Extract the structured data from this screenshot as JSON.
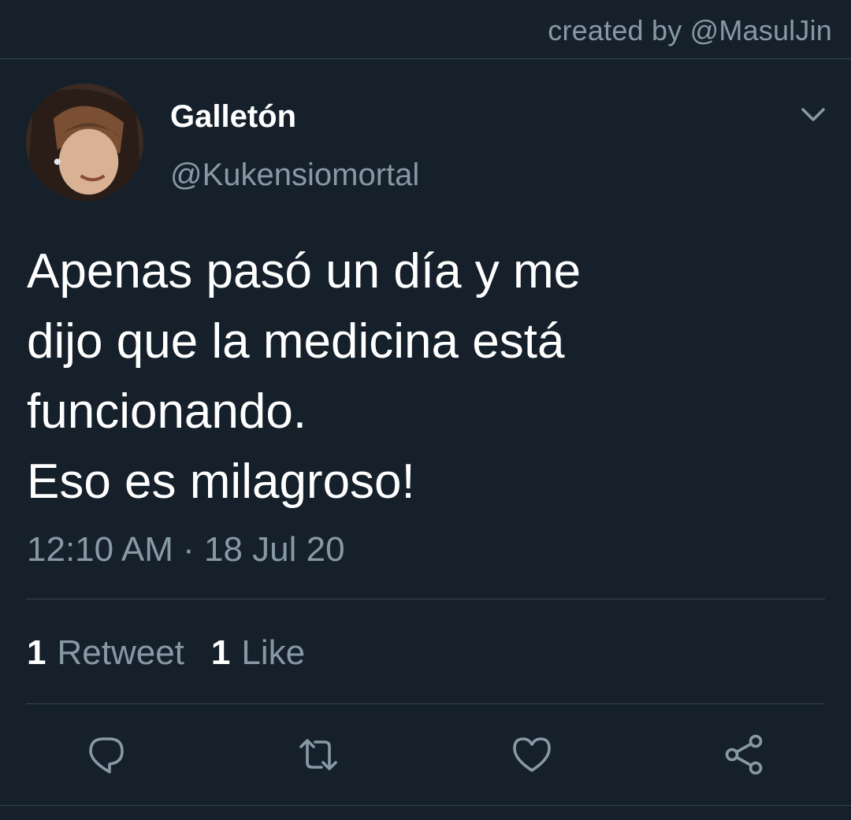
{
  "watermark": "created by @MasulJin",
  "tweet": {
    "display_name": "Galletón",
    "handle": "@Kukensiomortal",
    "text_lines": [
      "Apenas pasó un día y me",
      "dijo que la medicina está",
      "funcionando.",
      "Eso es milagroso!"
    ],
    "timestamp": "12:10 AM · 18 Jul 20",
    "stats": {
      "retweets_count": "1",
      "retweets_label": "Retweet",
      "likes_count": "1",
      "likes_label": "Like"
    }
  },
  "icons": {
    "more": "chevron-down-icon",
    "reply": "reply-icon",
    "retweet": "retweet-icon",
    "like": "heart-icon",
    "share": "share-icon"
  },
  "colors": {
    "background": "#15202b",
    "secondary_text": "#8899a6",
    "divider": "#38444d"
  }
}
